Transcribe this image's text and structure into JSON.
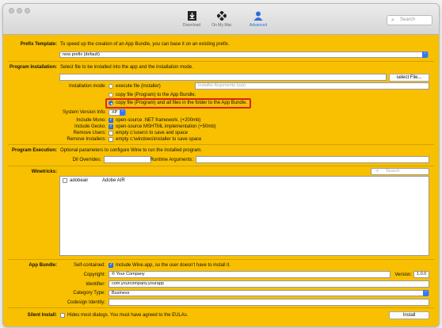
{
  "toolbar": {
    "download": {
      "label": "Download",
      "icon": "download-icon"
    },
    "on_my_mac": {
      "label": "On My Mac",
      "icon": "grid-icon"
    },
    "advanced": {
      "label": "Advanced",
      "icon": "gear-person-icon"
    },
    "search_placeholder": "Search"
  },
  "prefix": {
    "label": "Prefix Template:",
    "description": "To speed up the creation of an App Bundle, you can base it on an existing prefix.",
    "selected": "new prefix (default)"
  },
  "program_installation": {
    "label": "Program Installation:",
    "description": "Select file to be installed into the app and the installation mode.",
    "select_file_button": "select File...",
    "installation_mode_label": "Installation mode:",
    "options": [
      {
        "label": "execute file (installer)",
        "selected": false
      },
      {
        "label": "copy file (Program)  to the App Bundle.",
        "selected": false
      },
      {
        "label": "copy file (Program)  and all files in the folder to the App Bundle.",
        "selected": true
      }
    ],
    "installer_args_placeholder": "Installer Arguments (opt)",
    "system_version_label": "System Version Info:",
    "system_version": "XP",
    "include_mono_label": "Include Mono:",
    "include_mono_text": "open-source .NET framework. (+200mb)",
    "include_gecko_label": "Include Gecko:",
    "include_gecko_text": "open-source MSHTML implementation (+50mb)",
    "remove_users_label": "Remove Users:",
    "remove_users_text": "empty c:\\users\\ to save and space",
    "remove_installers_label": "Remove Installers:",
    "remove_installers_text": "empty c:\\windows\\installer to save space"
  },
  "program_execution": {
    "label": "Program Execution:",
    "description": "Optional parameters to configure Wine to run the installed program.",
    "dll_overrides_label": "Dll Overrides:",
    "runtime_args_label": "Runtime Arguments:"
  },
  "winetricks": {
    "label": "Winetricks:",
    "search_placeholder": "Search",
    "items": [
      {
        "name": "adobeair",
        "description": "Adobe AIR",
        "checked": false
      }
    ]
  },
  "app_bundle": {
    "label": "App Bundle:",
    "self_contained_label": "Self-contained:",
    "self_contained_text": "Include Wine.app, so the user doesn't have to install it.",
    "copyright_label": "Copyright:",
    "copyright_value": "© Your Company",
    "version_label": "Version:",
    "version_value": "1.0.0",
    "identifier_label": "Identifier:",
    "identifier_value": "com.yourcompany.yourapp",
    "category_label": "Category Type:",
    "category_value": "Business",
    "codesign_label": "Codesign Identity:"
  },
  "silent_install": {
    "label": "Silent Install:",
    "text": "Hides most dialogs. You must have agreed to the EULAs."
  },
  "install_button": "Install",
  "colors": {
    "background": "#f8c000",
    "accent": "#3478f6",
    "highlight_box": "#d9251d"
  }
}
